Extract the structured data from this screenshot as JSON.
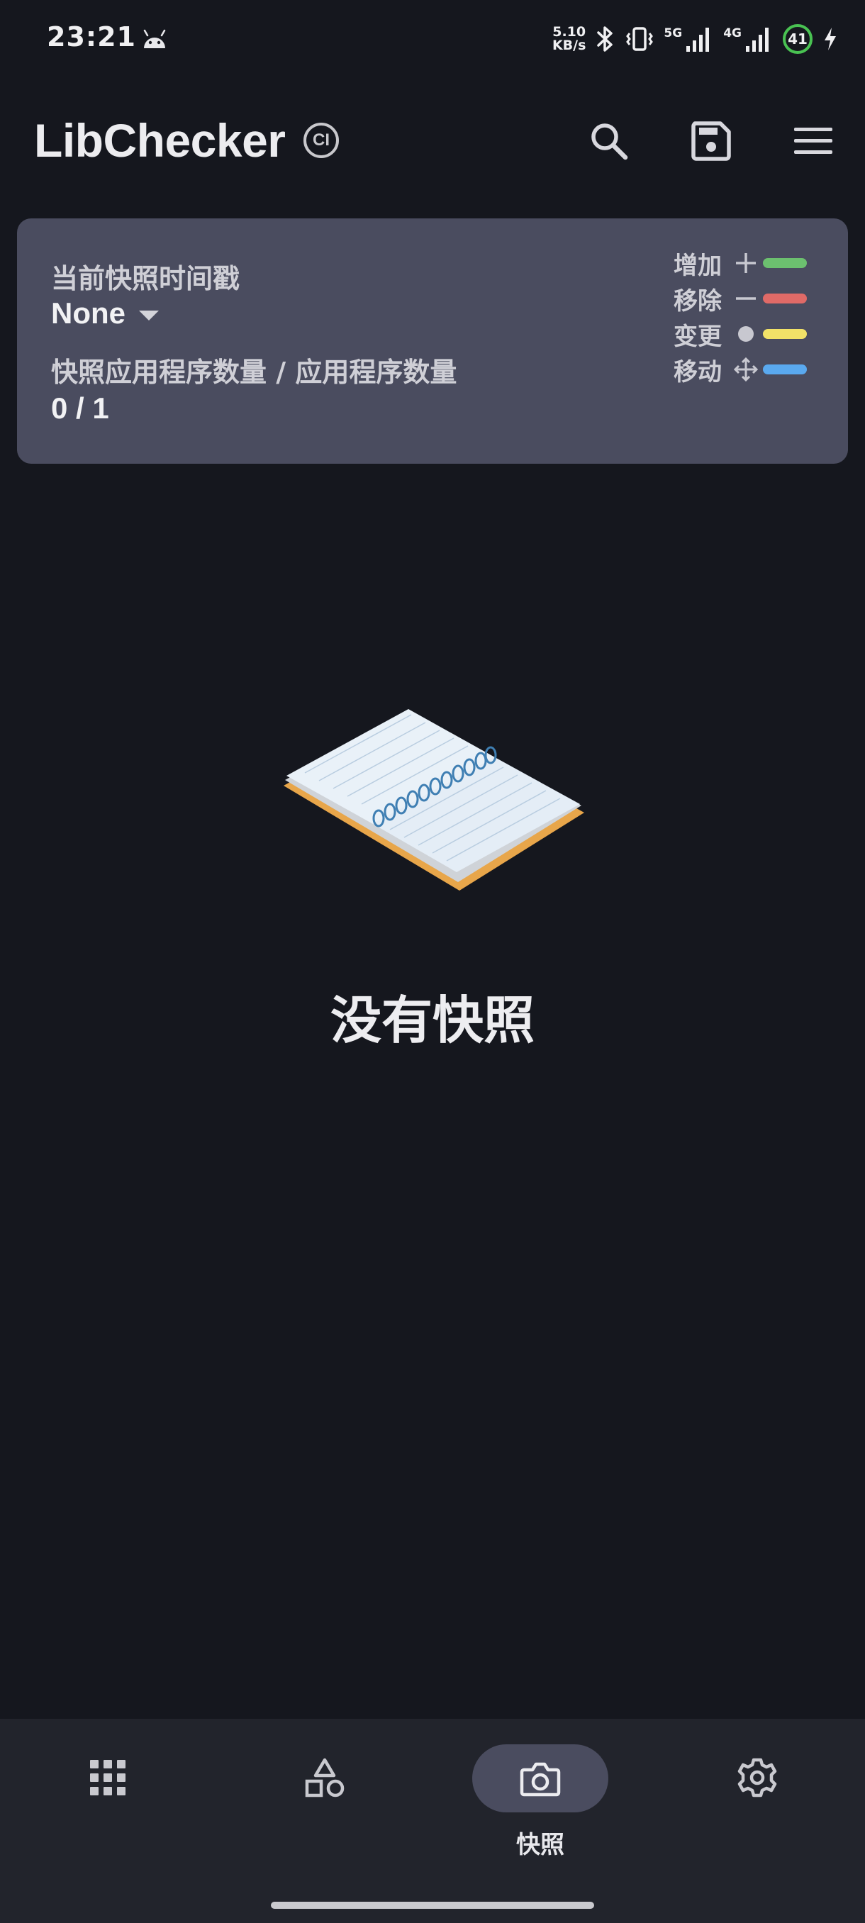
{
  "status_bar": {
    "time": "23:21",
    "net_speed_value": "5.10",
    "net_speed_unit": "KB/s",
    "signal_1_label": "5G",
    "signal_2_label": "4G",
    "battery_level": "41"
  },
  "toolbar": {
    "title": "LibChecker",
    "badge": "CI"
  },
  "snapshot_card": {
    "timestamp_label": "当前快照时间戳",
    "timestamp_value": "None",
    "count_label": "快照应用程序数量 / 应用程序数量",
    "count_value": "0 / 1",
    "legend": [
      {
        "label": "增加",
        "symbol": "plus-icon",
        "color": "#6cc06f"
      },
      {
        "label": "移除",
        "symbol": "minus-icon",
        "color": "#e06a67"
      },
      {
        "label": "变更",
        "symbol": "dot-icon",
        "color": "#f2e268"
      },
      {
        "label": "移动",
        "symbol": "move-icon",
        "color": "#5aa9ef"
      }
    ]
  },
  "empty_state": {
    "title": "没有快照"
  },
  "bottom_nav": {
    "items": [
      {
        "icon": "apps-grid-icon",
        "label": ""
      },
      {
        "icon": "shapes-icon",
        "label": ""
      },
      {
        "icon": "camera-icon",
        "label": "快照",
        "selected": true
      },
      {
        "icon": "gear-icon",
        "label": ""
      }
    ]
  },
  "colors": {
    "background": "#15171e",
    "card": "#4a4c5f",
    "nav_background": "#22242c",
    "battery_ring": "#49c252"
  }
}
